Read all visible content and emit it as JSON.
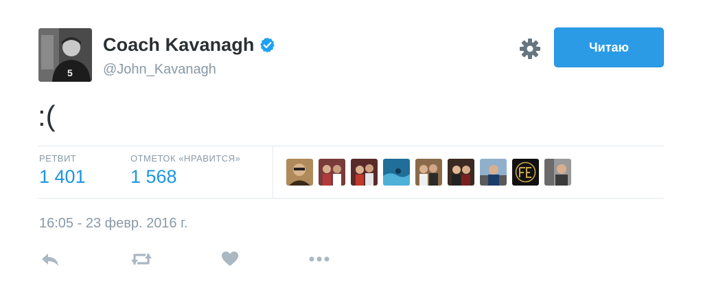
{
  "user": {
    "display_name": "Coach Kavanagh",
    "handle": "@John_Kavanagh",
    "verified": true,
    "avatar_icon": "profile-photo"
  },
  "header": {
    "settings_icon": "gear-icon",
    "follow_label": "Читаю"
  },
  "tweet": {
    "text": ":("
  },
  "stats": {
    "retweets_label": "РЕТВИТ",
    "retweets_value": "1 401",
    "likes_label": "ОТМЕТОК «НРАВИТСЯ»",
    "likes_value": "1 568"
  },
  "likers": [
    {
      "icon": "liker-avatar-1"
    },
    {
      "icon": "liker-avatar-2"
    },
    {
      "icon": "liker-avatar-3"
    },
    {
      "icon": "liker-avatar-4"
    },
    {
      "icon": "liker-avatar-5"
    },
    {
      "icon": "liker-avatar-6"
    },
    {
      "icon": "liker-avatar-7"
    },
    {
      "icon": "liker-avatar-fe-logo"
    },
    {
      "icon": "liker-avatar-9"
    }
  ],
  "meta": {
    "timestamp": "16:05 - 23 февр. 2016 г."
  },
  "actions": {
    "reply_icon": "reply-icon",
    "retweet_icon": "retweet-icon",
    "like_icon": "heart-icon",
    "more_icon": "more-icon"
  },
  "colors": {
    "accent": "#1b95e0",
    "button": "#2b9be6",
    "muted": "#8899a6",
    "action_icon": "#aab8c2",
    "verified": "#1da1f2"
  }
}
